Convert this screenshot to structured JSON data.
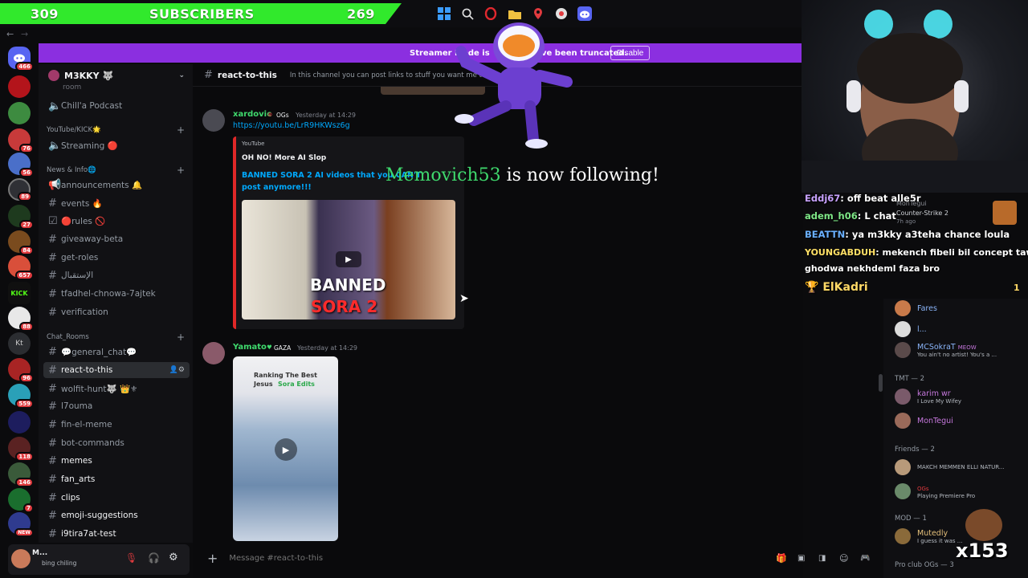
{
  "overlay": {
    "subscribers_current": "309",
    "subscribers_label": "SUBSCRIBERS",
    "subscribers_goal": "269",
    "follow_user": "Memovich53",
    "follow_text": "is now following!",
    "cheer_count": "x153"
  },
  "banner": {
    "left_text": "Streamer Mode is",
    "right_text": "ve been truncated.",
    "disable_label": "Disable"
  },
  "server": {
    "name": "M3KKY 🐺"
  },
  "rail_badges": [
    "466",
    "76",
    "56",
    "89",
    "27",
    "84",
    "657",
    "88",
    "96",
    "559",
    "118",
    "146",
    "7",
    "NEW"
  ],
  "sidebar": {
    "items": [
      {
        "label": "Chill'a Podcast"
      },
      {
        "label": "YouTube/KICK🌟"
      },
      {
        "label": "Streaming 🔴"
      },
      {
        "label": "News & Info🌐"
      },
      {
        "label": "announcements 🔔"
      },
      {
        "label": "events 🔥"
      },
      {
        "label": "🔴rules 🚫"
      },
      {
        "label": "giveaway-beta"
      },
      {
        "label": "get-roles"
      },
      {
        "label": "الإستقبال"
      },
      {
        "label": "tfadhel-chnowa-7ajtek"
      },
      {
        "label": "verification"
      },
      {
        "label": "Chat_Rooms"
      },
      {
        "label": "💬general_chat💬"
      },
      {
        "label": "react-to-this"
      },
      {
        "label": "wolfit-hunt🐺 👑⚜"
      },
      {
        "label": "l7ouma"
      },
      {
        "label": "fin-el-meme"
      },
      {
        "label": "bot-commands"
      },
      {
        "label": "memes"
      },
      {
        "label": "fan_arts"
      },
      {
        "label": "clips"
      },
      {
        "label": "emoji-suggestions"
      },
      {
        "label": "i9tira7at-test"
      }
    ],
    "partial_top": "room"
  },
  "user_panel": {
    "name": "M...",
    "status": "bing chiling"
  },
  "channel": {
    "name": "react-to-this",
    "topic": "In this channel you can post links to stuff you want me to react to o"
  },
  "messages": [
    {
      "author": "xardovic",
      "badge": "OGs",
      "time": "Yesterday at 14:29",
      "link": "https://youtu.be/LrR9HKWsz6g",
      "embed": {
        "provider": "YouTube",
        "author": "OH NO! More AI Slop",
        "title": "BANNED SORA 2 AI videos that you CAN'T post anymore!!!",
        "thumb_line1": "BANNED",
        "thumb_line2": "SORA 2"
      }
    },
    {
      "author": "Yamato",
      "badge": "GAZA",
      "time": "Yesterday at 14:29",
      "video_title1": "Ranking The Best",
      "video_title2": "Jesus",
      "video_title3": "Sora Edits"
    }
  ],
  "message_input": {
    "placeholder": "Message #react-to-this"
  },
  "stream_chat": [
    {
      "user": "Eddj67",
      "text": ": off beat alle5r",
      "color": "#c8a2ff"
    },
    {
      "user": "adem_h06",
      "text": ": L chat",
      "color": "#7ee787"
    },
    {
      "user": "BEATTN",
      "text": ": ya m3kky a3teha chance loula",
      "color": "#6ab0ff"
    },
    {
      "user": "YOUNGABDUH",
      "text": ": mekench fibeli bil concept taw",
      "color": "#ffe066"
    },
    {
      "user": "",
      "text": "ghodwa nekhdeml faza bro",
      "color": "#ffffff"
    },
    {
      "user": "ElKadri",
      "text": "",
      "color": "#ffd966"
    }
  ],
  "stream_chat_count": "1",
  "members": {
    "rows": [
      {
        "name": "MonTegui",
        "sub": "Counter-Strike 2",
        "sub2": "7h ago",
        "color": "#949ba4"
      },
      {
        "name": "Fares",
        "sub": "",
        "color": "#8ab4f8"
      },
      {
        "name": "l...",
        "sub": "",
        "color": "#8ab4f8"
      },
      {
        "name": "MCSokraT",
        "tag": "MEOW",
        "sub": "You ain't no artist! You's a ...",
        "color": "#8ab4f8"
      },
      {
        "name": "karim wr",
        "sub": "I Love My Wifey",
        "color": "#c678dd"
      },
      {
        "name": "MonTegui",
        "sub": "",
        "color": "#c678dd"
      },
      {
        "name": "",
        "sub": "MAKCH MEMMEN ELLI NATUR...",
        "color": "#c678dd"
      },
      {
        "name": "",
        "tag": "OGs",
        "sub": "Playing Premiere Pro",
        "color": "#c678dd"
      },
      {
        "name": "Mutedly",
        "sub": "I guess it was ...",
        "color": "#e5c07b"
      }
    ],
    "groups": [
      "TMT — 2",
      "Friends — 2",
      "MOD — 1",
      "Pro club OGs — 3"
    ]
  }
}
